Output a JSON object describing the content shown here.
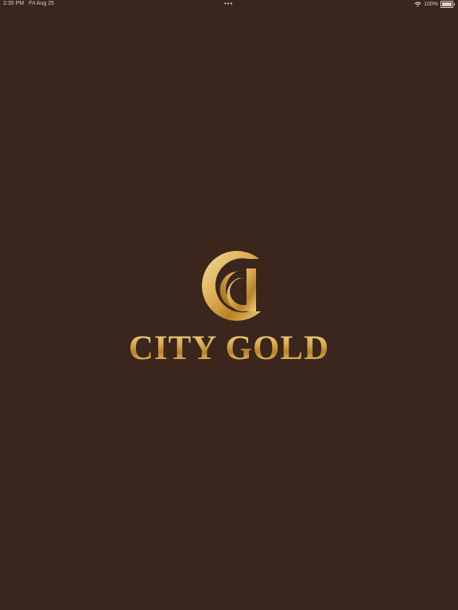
{
  "status_bar": {
    "time": "2:35 PM",
    "date": "Fri Aug 25",
    "multitask_indicator": "•••",
    "wifi_icon": "wifi-icon",
    "battery_percent": "100%",
    "battery_level": 1.0
  },
  "splash": {
    "logo_icon": "city-gold-cg-logo-icon",
    "brand_name": "CITY GOLD",
    "colors": {
      "background": "#3a261c",
      "gold_light": "#f6df9a",
      "gold_mid": "#d9aa4e",
      "gold_dark": "#9e6c1f"
    }
  }
}
